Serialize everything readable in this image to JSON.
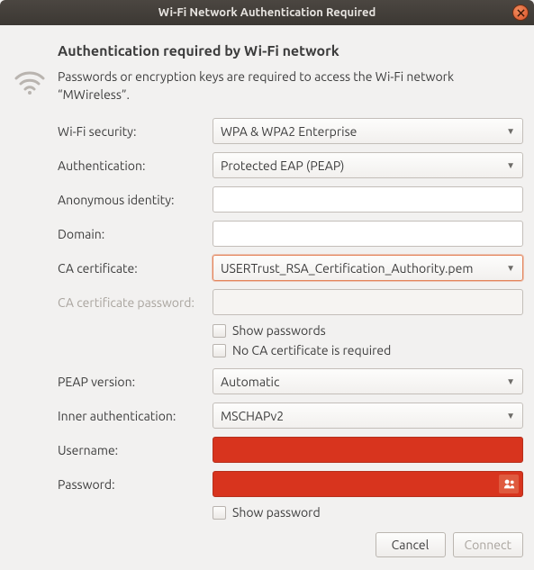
{
  "window": {
    "title": "Wi-Fi Network Authentication Required"
  },
  "heading": "Authentication required by Wi-Fi network",
  "subtext": "Passwords or encryption keys are required to access the Wi-Fi network “MWireless”.",
  "fields": {
    "wifi_security": {
      "label": "Wi-Fi security:",
      "value": "WPA & WPA2 Enterprise"
    },
    "authentication": {
      "label": "Authentication:",
      "value": "Protected EAP (PEAP)"
    },
    "anonymous_identity": {
      "label": "Anonymous identity:",
      "value": ""
    },
    "domain": {
      "label": "Domain:",
      "value": ""
    },
    "ca_certificate": {
      "label": "CA certificate:",
      "value": "USERTrust_RSA_Certification_Authority.pem"
    },
    "ca_cert_password": {
      "label": "CA certificate password:",
      "value": ""
    },
    "show_passwords": {
      "label": "Show passwords",
      "checked": false
    },
    "no_ca_required": {
      "label": "No CA certificate is required",
      "checked": false
    },
    "peap_version": {
      "label": "PEAP version:",
      "value": "Automatic"
    },
    "inner_auth": {
      "label": "Inner authentication:",
      "value": "MSCHAPv2"
    },
    "username": {
      "label": "Username:",
      "value": ""
    },
    "password": {
      "label": "Password:",
      "value": ""
    },
    "show_password": {
      "label": "Show password",
      "checked": false
    }
  },
  "buttons": {
    "cancel": "Cancel",
    "connect": "Connect"
  }
}
